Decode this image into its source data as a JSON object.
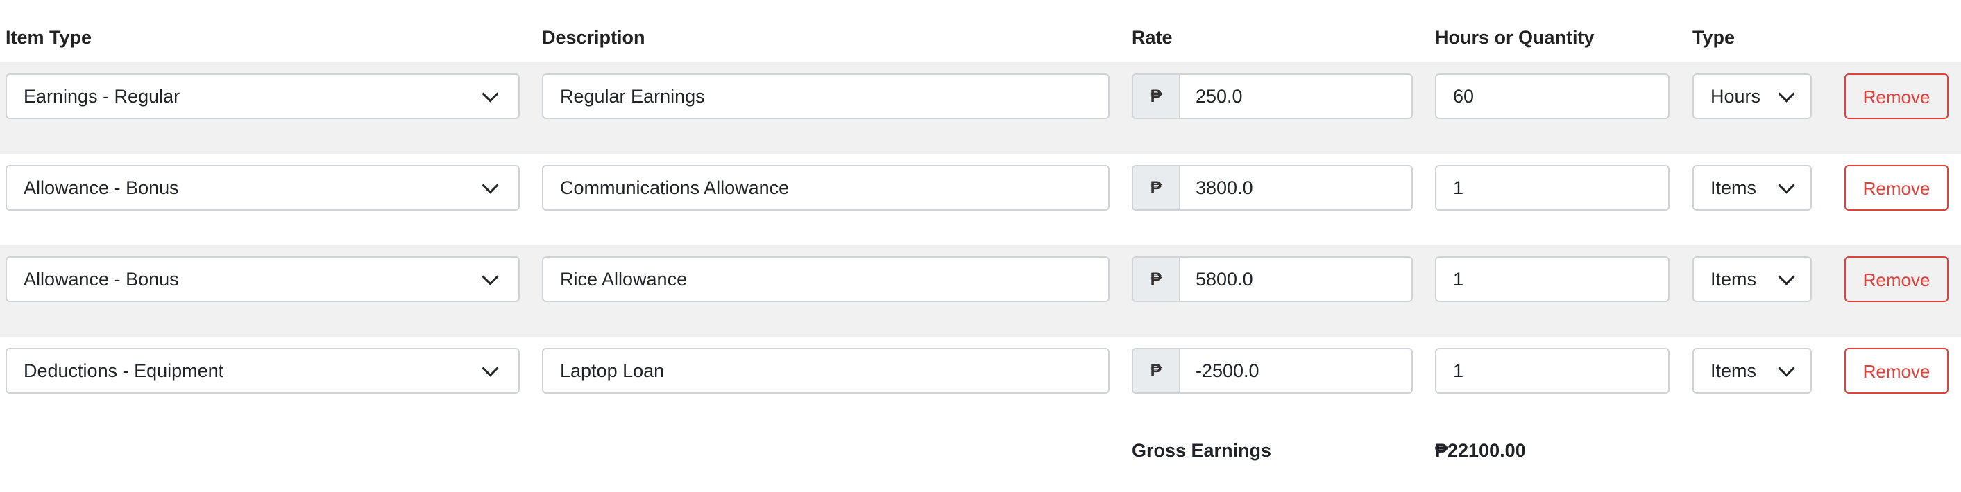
{
  "headers": {
    "item_type": "Item Type",
    "description": "Description",
    "rate": "Rate",
    "hours_or_quantity": "Hours or Quantity",
    "type": "Type"
  },
  "currency_symbol": "₱",
  "rows": [
    {
      "item_type": "Earnings - Regular",
      "description": "Regular Earnings",
      "rate": "250.0",
      "quantity": "60",
      "unit_type": "Hours",
      "remove_label": "Remove"
    },
    {
      "item_type": "Allowance - Bonus",
      "description": "Communications Allowance",
      "rate": "3800.0",
      "quantity": "1",
      "unit_type": "Items",
      "remove_label": "Remove"
    },
    {
      "item_type": "Allowance - Bonus",
      "description": "Rice Allowance",
      "rate": "5800.0",
      "quantity": "1",
      "unit_type": "Items",
      "remove_label": "Remove"
    },
    {
      "item_type": "Deductions - Equipment",
      "description": "Laptop Loan",
      "rate": "-2500.0",
      "quantity": "1",
      "unit_type": "Items",
      "remove_label": "Remove"
    }
  ],
  "footer": {
    "gross_label": "Gross Earnings",
    "gross_value": "₱22100.00"
  },
  "colors": {
    "remove_accent": "#e0413a",
    "row_stripe": "#f1f1f1",
    "prefix_bg": "#e9ecef"
  }
}
